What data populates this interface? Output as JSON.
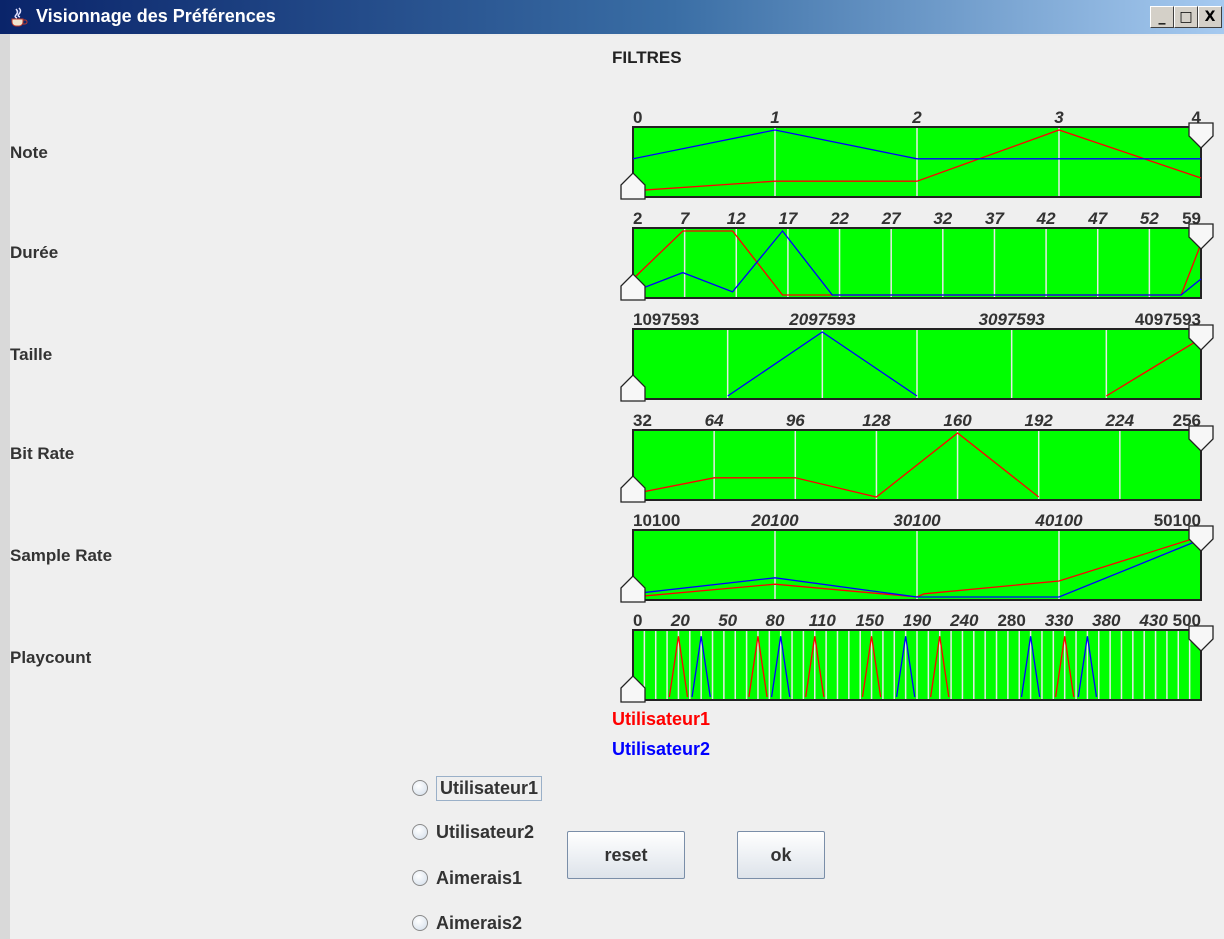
{
  "window": {
    "title": "Visionnage des Préférences",
    "controls": [
      "_",
      "□",
      "X"
    ]
  },
  "panel_title": "FILTRES",
  "colors": {
    "track": "#00ff00",
    "utilisateur1": "#ff0000",
    "utilisateur2": "#0000ff",
    "gridline": "#e8e8e8"
  },
  "filters": [
    {
      "label": "Note",
      "ticks": [
        "0",
        "1",
        "2",
        "3",
        "4"
      ],
      "tick_styles": [
        "upright",
        "italic",
        "italic",
        "italic",
        "upright"
      ],
      "min": 0,
      "max": 4,
      "gridlines": 4,
      "utilisateur1": [
        [
          0,
          0.05
        ],
        [
          1,
          0.2
        ],
        [
          2,
          0.2
        ],
        [
          3,
          1.0
        ],
        [
          4,
          0.25
        ]
      ],
      "utilisateur2": [
        [
          0,
          0.55
        ],
        [
          1,
          1.0
        ],
        [
          2,
          0.55
        ],
        [
          3,
          0.55
        ],
        [
          4,
          0.55
        ]
      ],
      "range_min": 0,
      "range_max": 4
    },
    {
      "label": "Durée",
      "ticks": [
        "2",
        "7",
        "12",
        "17",
        "22",
        "27",
        "32",
        "37",
        "42",
        "47",
        "52",
        "59"
      ],
      "tick_styles": [
        "upright",
        "italic",
        "italic",
        "italic",
        "italic",
        "italic",
        "italic",
        "italic",
        "italic",
        "italic",
        "italic",
        "upright"
      ],
      "min": 2,
      "max": 59,
      "gridlines": 11,
      "utilisateur1": [
        [
          2,
          0.25
        ],
        [
          7,
          1.0
        ],
        [
          12,
          1.0
        ],
        [
          17,
          0.0
        ],
        [
          57,
          0.0
        ],
        [
          59,
          0.8
        ]
      ],
      "utilisateur2": [
        [
          2,
          0.05
        ],
        [
          7,
          0.35
        ],
        [
          12,
          0.05
        ],
        [
          17,
          1.0
        ],
        [
          22,
          0.0
        ],
        [
          57,
          0.0
        ],
        [
          59,
          0.25
        ]
      ],
      "range_min": 2,
      "range_max": 59
    },
    {
      "label": "Taille",
      "ticks": [
        "1097593",
        "2097593",
        "3097593",
        "4097593"
      ],
      "tick_styles": [
        "upright",
        "italic",
        "italic",
        "upright"
      ],
      "min": 1097593,
      "max": 4097593,
      "gridlines": 6,
      "utilisateur1": [
        [
          3597593,
          0.0
        ],
        [
          4097593,
          0.9
        ]
      ],
      "utilisateur2": [
        [
          1597593,
          0.0
        ],
        [
          2097593,
          1.0
        ],
        [
          2597593,
          0.0
        ]
      ],
      "range_min": 1097593,
      "range_max": 4097593
    },
    {
      "label": "Bit Rate",
      "ticks": [
        "32",
        "64",
        "96",
        "128",
        "160",
        "192",
        "224",
        "256"
      ],
      "tick_styles": [
        "upright",
        "italic",
        "italic",
        "italic",
        "italic",
        "italic",
        "italic",
        "upright"
      ],
      "min": 32,
      "max": 256,
      "gridlines": 7,
      "utilisateur1": [
        [
          32,
          0.05
        ],
        [
          64,
          0.3
        ],
        [
          96,
          0.3
        ],
        [
          128,
          0.0
        ],
        [
          160,
          1.0
        ],
        [
          192,
          0.0
        ]
      ],
      "utilisateur2": [],
      "range_min": 32,
      "range_max": 256
    },
    {
      "label": "Sample Rate",
      "ticks": [
        "10100",
        "20100",
        "30100",
        "40100",
        "50100"
      ],
      "tick_styles": [
        "upright",
        "italic",
        "italic",
        "italic",
        "upright"
      ],
      "min": 10100,
      "max": 50100,
      "gridlines": 4,
      "utilisateur1": [
        [
          10100,
          0.0
        ],
        [
          20100,
          0.2
        ],
        [
          30100,
          0.0
        ],
        [
          30600,
          0.05
        ],
        [
          40100,
          0.25
        ],
        [
          50100,
          0.95
        ]
      ],
      "utilisateur2": [
        [
          10100,
          0.05
        ],
        [
          20100,
          0.3
        ],
        [
          30100,
          0.0
        ],
        [
          40100,
          0.0
        ],
        [
          50100,
          0.9
        ]
      ],
      "range_min": 10100,
      "range_max": 50100
    },
    {
      "label": "Playcount",
      "ticks": [
        "0",
        "20",
        "50",
        "80",
        "110",
        "150",
        "190",
        "240",
        "280",
        "330",
        "380",
        "430",
        "500"
      ],
      "tick_styles": [
        "upright",
        "italic",
        "italic",
        "italic",
        "italic",
        "italic",
        "italic",
        "italic",
        "upright",
        "italic",
        "italic",
        "italic",
        "upright"
      ],
      "min": 0,
      "max": 500,
      "gridlines": 50,
      "utilisateur1_peaks": [
        40,
        110,
        160,
        210,
        270,
        380
      ],
      "utilisateur2_peaks": [
        60,
        130,
        240,
        350,
        400
      ],
      "range_min": 0,
      "range_max": 500
    }
  ],
  "legend": {
    "user1": "Utilisateur1",
    "user2": "Utilisateur2"
  },
  "radios": [
    {
      "label": "Utilisateur1",
      "checked": false,
      "focused": true
    },
    {
      "label": "Utilisateur2",
      "checked": false,
      "focused": false
    },
    {
      "label": "Aimerais1",
      "checked": false,
      "focused": false
    },
    {
      "label": "Aimerais2",
      "checked": false,
      "focused": false
    }
  ],
  "buttons": {
    "reset": "reset",
    "ok": "ok"
  }
}
